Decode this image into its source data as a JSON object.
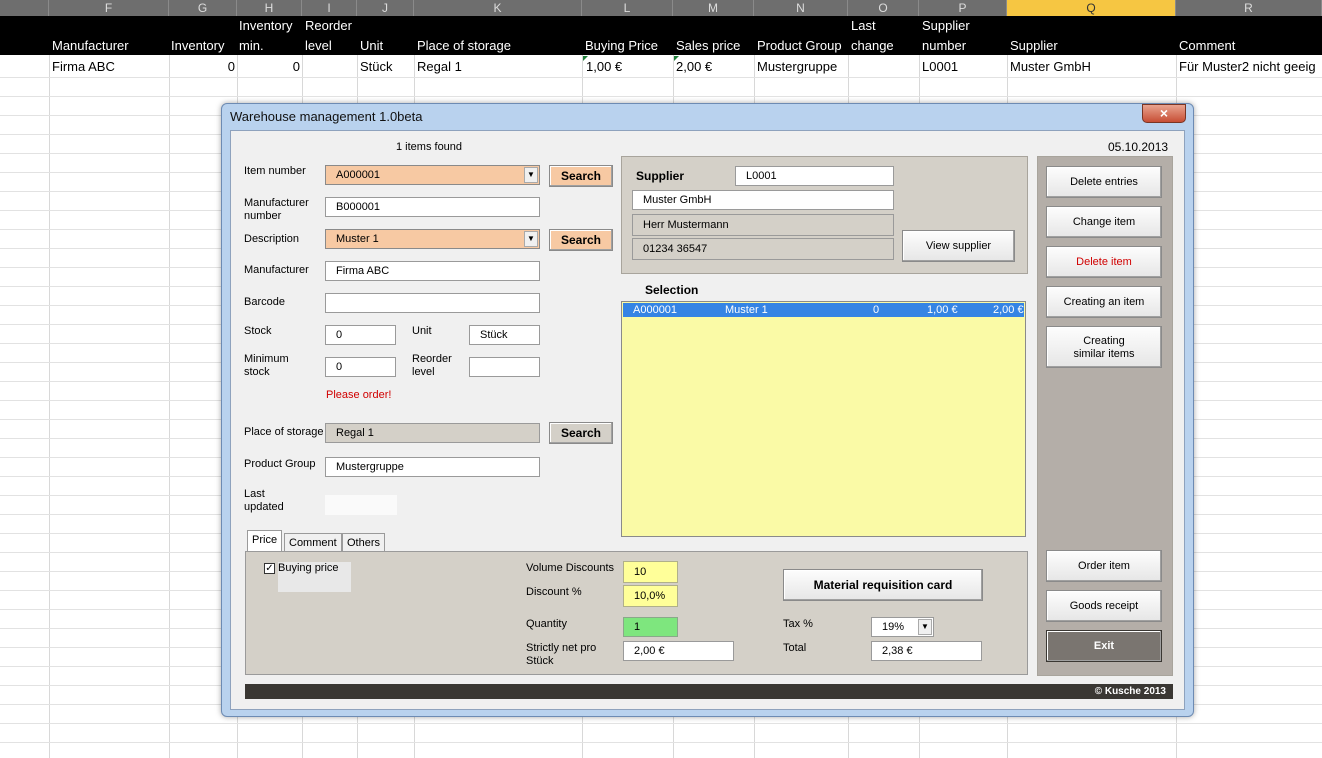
{
  "sheet": {
    "columns": [
      "F",
      "G",
      "H",
      "I",
      "J",
      "K",
      "L",
      "M",
      "N",
      "O",
      "P",
      "Q",
      "R"
    ],
    "active_column": "Q",
    "headers": {
      "manufacturer": "Manufacturer",
      "inventory": "Inventory",
      "inventory_min": [
        "Inventory",
        "min."
      ],
      "reorder": [
        "Reorder",
        "level"
      ],
      "unit": "Unit",
      "storage": "Place of storage",
      "buying": "Buying Price",
      "sales": "Sales price",
      "group": "Product Group",
      "last_change": [
        "Last",
        "change"
      ],
      "supplier_number": [
        "Supplier",
        "number"
      ],
      "supplier": "Supplier",
      "comment": "Comment"
    },
    "row": {
      "manufacturer": "Firma ABC",
      "inventory": "0",
      "inventory_min": "0",
      "unit": "Stück",
      "storage": "Regal 1",
      "buying": "1,00 €",
      "sales": "2,00 €",
      "group": "Mustergruppe",
      "supplier_number": "L0001",
      "supplier": "Muster GmbH",
      "comment": "Für Muster2 nicht geeig"
    }
  },
  "dialog": {
    "title": "Warehouse management 1.0beta",
    "close": "×",
    "items_found": "1 items found",
    "date": "05.10.2013",
    "labels": {
      "item_number": "Item number",
      "manufacturer_number": [
        "Manufacturer",
        "number"
      ],
      "description": "Description",
      "manufacturer": "Manufacturer",
      "barcode": "Barcode",
      "stock": "Stock",
      "unit": "Unit",
      "minimum_stock": [
        "Minimum",
        "stock"
      ],
      "reorder_level": [
        "Reorder",
        "level"
      ],
      "please_order": "Please order!",
      "place_of_storage": "Place of storage",
      "product_group": "Product Group",
      "last_updated": [
        "Last",
        "updated"
      ]
    },
    "values": {
      "item_number": "A000001",
      "manufacturer_number": "B000001",
      "description": "Muster 1",
      "manufacturer": "Firma ABC",
      "barcode": "",
      "stock": "0",
      "unit": "Stück",
      "minimum_stock": "0",
      "reorder_level": "",
      "place_of_storage": "Regal 1",
      "product_group": "Mustergruppe",
      "last_updated": ""
    },
    "search_label": "Search",
    "supplier": {
      "label": "Supplier",
      "number": "L0001",
      "name": "Muster GmbH",
      "contact": "Herr Mustermann",
      "phone": "01234 36547",
      "view_button": "View supplier"
    },
    "selection": {
      "title": "Selection",
      "row": [
        "A000001",
        "Muster 1",
        "0",
        "1,00 €",
        "2,00 €"
      ]
    },
    "side_buttons": {
      "delete_entries": "Delete entries",
      "change_item": "Change item",
      "delete_item": "Delete item",
      "creating_item": "Creating an item",
      "creating_similar": [
        "Creating",
        "similar items"
      ],
      "order_item": "Order item",
      "goods_receipt": "Goods receipt",
      "exit": "Exit"
    },
    "tabs": [
      "Price",
      "Comment",
      "Others"
    ],
    "price": {
      "buying_price_label": "Buying price",
      "buying_price_checked": true,
      "volume_discounts_label": "Volume Discounts",
      "volume_discounts": "10",
      "discount_label": "Discount %",
      "discount": "10,0%",
      "quantity_label": "Quantity",
      "quantity": "1",
      "net_label": [
        "Strictly net pro",
        "Stück"
      ],
      "net": "2,00 €",
      "requisition_button": "Material requisition card",
      "tax_label": "Tax %",
      "tax": "19%",
      "total_label": "Total",
      "total": "2,38 €"
    },
    "footer": "© Kusche 2013"
  },
  "colors": {
    "accent_orange": "#f7c9a3",
    "selection_blue": "#3584e4",
    "list_yellow": "#fafaa6",
    "alert_red": "#d00000",
    "exit_dark": "#7a7570"
  }
}
